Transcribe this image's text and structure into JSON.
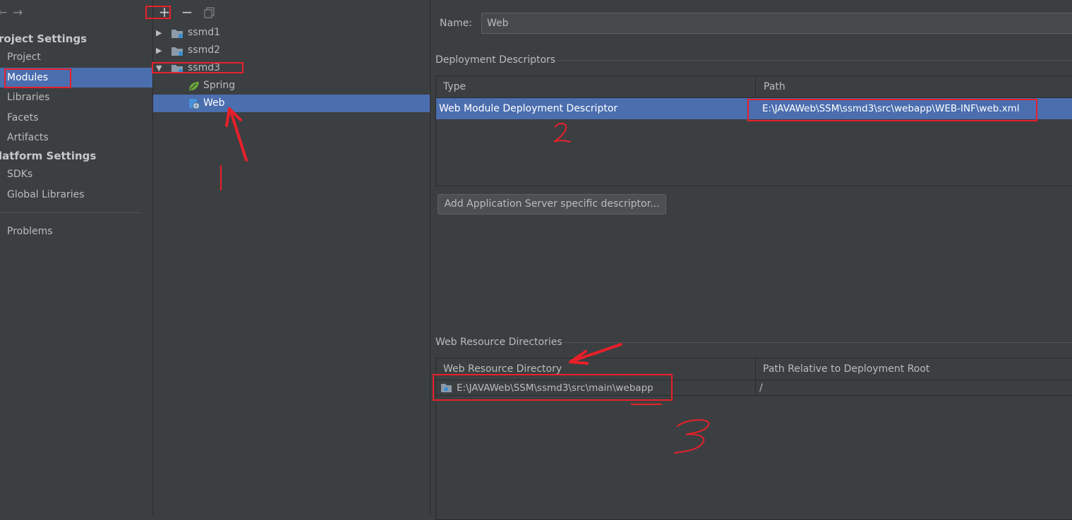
{
  "nav": {
    "back_icon": "arrow-left-icon",
    "forward_icon": "arrow-right-icon",
    "project_settings_title": "roject Settings",
    "project_items": [
      "Project",
      "Modules",
      "Libraries",
      "Facets",
      "Artifacts"
    ],
    "platform_settings_title": "latform Settings",
    "platform_items": [
      "SDKs",
      "Global Libraries"
    ],
    "problems": "Problems",
    "selected": "Modules"
  },
  "toolbar": {
    "add": "+",
    "remove": "−",
    "copy_icon": "copy-icon"
  },
  "tree": {
    "modules": [
      {
        "name": "ssmd1",
        "expanded": false
      },
      {
        "name": "ssmd2",
        "expanded": false
      },
      {
        "name": "ssmd3",
        "expanded": true,
        "children": [
          "Spring",
          "Web"
        ]
      }
    ],
    "selected": "Web"
  },
  "detail": {
    "name_label": "Name:",
    "name_value": "Web",
    "deployment_title": "Deployment Descriptors",
    "dd_columns": [
      "Type",
      "Path"
    ],
    "dd_rows": [
      {
        "type": "Web Module Deployment Descriptor",
        "path": "E:\\JAVAWeb\\SSM\\ssmd3\\src\\webapp\\WEB-INF\\web.xml"
      }
    ],
    "add_server_button": "Add Application Server specific descriptor...",
    "web_resource_title": "Web Resource Directories",
    "wr_columns": [
      "Web Resource Directory",
      "Path Relative to Deployment Root"
    ],
    "wr_rows": [
      {
        "dir": "E:\\JAVAWeb\\SSM\\ssmd3\\src\\main\\webapp",
        "rel": "/"
      }
    ]
  },
  "annotations": {
    "mark1": "|",
    "mark2": "2",
    "mark3": "3"
  },
  "colors": {
    "background": "#3c3f41",
    "selection": "#4b6eaf",
    "annotation_red": "#e8202a"
  }
}
